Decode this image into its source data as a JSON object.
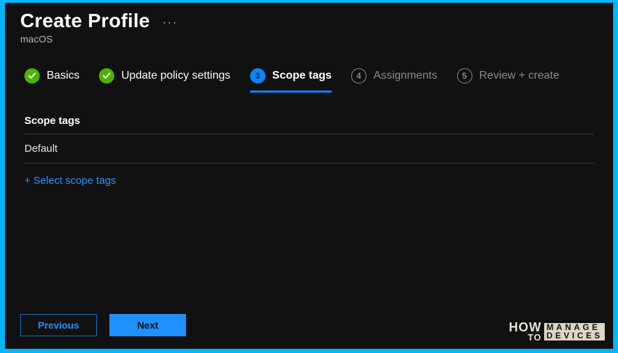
{
  "header": {
    "title": "Create Profile",
    "subtitle": "macOS"
  },
  "steps": [
    {
      "label": "Basics",
      "state": "completed",
      "num": ""
    },
    {
      "label": "Update policy settings",
      "state": "completed",
      "num": ""
    },
    {
      "label": "Scope tags",
      "state": "active",
      "num": "3"
    },
    {
      "label": "Assignments",
      "state": "upcoming",
      "num": "4"
    },
    {
      "label": "Review + create",
      "state": "upcoming",
      "num": "5"
    }
  ],
  "section": {
    "title": "Scope tags",
    "tags": [
      "Default"
    ],
    "add_link": "+ Select scope tags"
  },
  "footer": {
    "previous": "Previous",
    "next": "Next"
  },
  "watermark": {
    "how": "HOW",
    "to": "TO",
    "line1": "MANAGE",
    "line2": "DEVICES"
  }
}
